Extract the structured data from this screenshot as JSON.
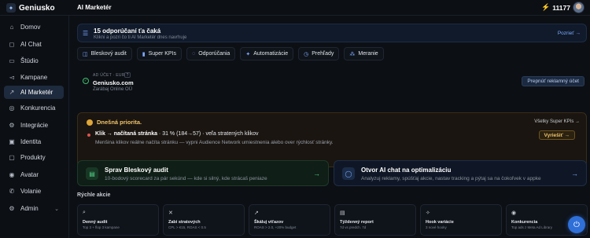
{
  "app": {
    "name": "Geniusko",
    "page_title": "AI Marketér",
    "credits": "11177"
  },
  "sidebar": {
    "items": [
      {
        "label": "Domov",
        "icon": "home-icon",
        "glyph": "⌂"
      },
      {
        "label": "AI Chat",
        "icon": "chat-icon",
        "glyph": "◻"
      },
      {
        "label": "Štúdio",
        "icon": "studio-icon",
        "glyph": "▭"
      },
      {
        "label": "Kampane",
        "icon": "megaphone-icon",
        "glyph": "◅"
      },
      {
        "label": "AI Marketér",
        "icon": "trend-icon",
        "glyph": "↗",
        "active": true
      },
      {
        "label": "Konkurencia",
        "icon": "target-icon",
        "glyph": "◎"
      },
      {
        "label": "Integrácie",
        "icon": "plug-icon",
        "glyph": "⚙"
      },
      {
        "label": "Identita",
        "icon": "id-icon",
        "glyph": "▣"
      },
      {
        "label": "Produkty",
        "icon": "box-icon",
        "glyph": "▢"
      },
      {
        "label": "Avatar",
        "icon": "avatar-icon",
        "glyph": "◉"
      },
      {
        "label": "Volanie",
        "icon": "phone-icon",
        "glyph": "✆"
      },
      {
        "label": "Admin",
        "icon": "gear-icon",
        "glyph": "⚙"
      }
    ]
  },
  "recommendations": {
    "title": "15 odporúčaní ťa čaká",
    "subtitle": "Klikni a pozri čo ti AI Marketér dnes navrhuje",
    "link": "Pozrieť →"
  },
  "tabs": [
    {
      "label": "Bleskový audit",
      "icon": "bolt-icon",
      "glyph": "◫"
    },
    {
      "label": "Super KPIs",
      "icon": "chart-icon",
      "glyph": "▮"
    },
    {
      "label": "Odporúčania",
      "icon": "bulb-icon",
      "glyph": "◌"
    },
    {
      "label": "Automatizácie",
      "icon": "automation-icon",
      "glyph": "✦"
    },
    {
      "label": "Prehľady",
      "icon": "clock-icon",
      "glyph": "◷"
    },
    {
      "label": "Meranie",
      "icon": "network-icon",
      "glyph": "⁂"
    }
  ],
  "account": {
    "meta": "AD ÚČET · EUR",
    "info": "?",
    "name": "Geniusko.com",
    "company": "Zarábaj Online OÜ",
    "switch_label": "Prepnúť reklamný účet"
  },
  "priority": {
    "title": "Dnešná priorita.",
    "link": "Všetky Super KPIs →",
    "metric_bold": "Klik → načítaná stránka",
    "metric_rest": " · 31 % (184→57) · veľa stratených klikov",
    "description": "Menšina klikov reálne načíta stránku — vypni Audience Network umiestnenia alebo over rýchlosť stránky.",
    "button": "Vyriešiť →"
  },
  "actions": [
    {
      "title": "Sprav Bleskový audit",
      "subtitle": "10-bodový scorecard za pár sekúnd — kde si silný, kde strácaš peniaze",
      "glyph": "▤",
      "arrow": "→"
    },
    {
      "title": "Otvor AI chat na optimalizáciu",
      "subtitle": "Analyzuj reklamy, spúšťaj akcie, nastav tracking a pýtaj sa na čokoľvek v appke",
      "glyph": "◯",
      "arrow": "→"
    }
  ],
  "quick": {
    "title": "Rýchle akcie",
    "items": [
      {
        "title": "Denný audit",
        "subtitle": "Top 3 + flop 3 kampane",
        "glyph": "⌕"
      },
      {
        "title": "Zabi stratových",
        "subtitle": "CPL > €15, ROAS < 0.5",
        "glyph": "✕"
      },
      {
        "title": "Škáluj víťazov",
        "subtitle": "ROAS > 2.0, +20% budget",
        "glyph": "↗"
      },
      {
        "title": "Týždenný report",
        "subtitle": "7d vs predch. 7d",
        "glyph": "▤"
      },
      {
        "title": "Hook variácie",
        "subtitle": "3 nové hooky",
        "glyph": "✧"
      },
      {
        "title": "Konkurencia",
        "subtitle": "Top ads z Meta Ad Library",
        "glyph": "◉"
      }
    ]
  }
}
